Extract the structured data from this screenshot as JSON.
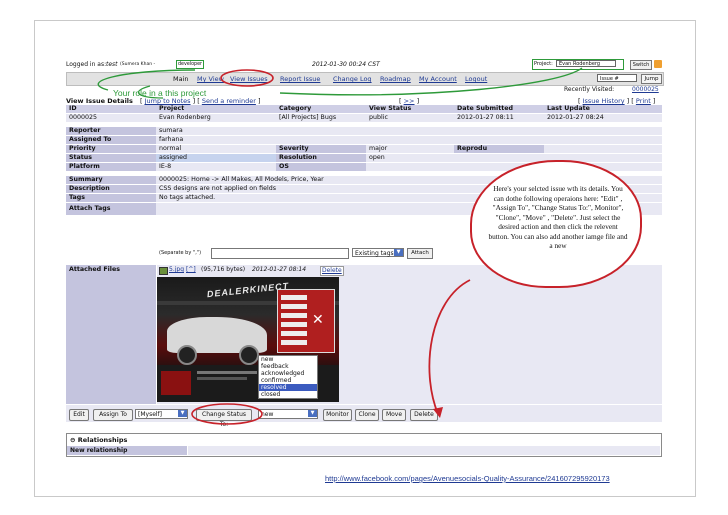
{
  "header": {
    "logged_in_prefix": "Logged in as:",
    "username": "test",
    "user_fullname": "(Sumera Khan -",
    "role": "developer",
    "role_suffix": ")",
    "datetime": "2012-01-30 00:24 CST",
    "project_label": "Project:",
    "project_value": "Evan Rodenberg",
    "switch_button": "Switch",
    "issue_input_placeholder": "Issue #",
    "jump_button": "Jump",
    "recently_visited_label": "Recently Visited:",
    "recently_visited_value": "0000025"
  },
  "nav": {
    "items": [
      "Main",
      "My View",
      "View Issues",
      "Report Issue",
      "Change Log",
      "Roadmap",
      "My Account",
      "Logout"
    ],
    "separator": "|"
  },
  "annotation_role": "Your role in a this project",
  "issue": {
    "section_title": "View Issue Details",
    "jump_to_notes": "Jump to Notes",
    "send_reminder": "Send a reminder",
    "next_link": ">>",
    "issue_history": "Issue History",
    "print": "Print",
    "columns": [
      "ID",
      "Project",
      "Category",
      "View Status",
      "Date Submitted",
      "Last Update"
    ],
    "values": [
      "0000025",
      "Evan Rodenberg",
      "[All Projects] Bugs",
      "public",
      "2012-01-27 08:11",
      "2012-01-27 08:24"
    ],
    "reporter_label": "Reporter",
    "reporter": "sumara",
    "assigned_label": "Assigned To",
    "assigned": "farhana",
    "priority_label": "Priority",
    "priority": "normal",
    "severity_label": "Severity",
    "severity": "major",
    "reproducibility_label": "Reprodu",
    "status_label": "Status",
    "status": "assigned",
    "resolution_label": "Resolution",
    "resolution": "open",
    "platform_label": "Platform",
    "platform": "IE-8",
    "os_label": "OS",
    "summary_label": "Summary",
    "summary": "0000025: Home -> All Makes, All Models, Price, Year",
    "description_label": "Description",
    "description": "CSS designs are not applied on fields",
    "tags_label": "Tags",
    "tags": "No tags attached.",
    "attach_tags_label": "Attach Tags",
    "separate_hint": "(Separate by \",\")",
    "existing_tags": "Existing tags",
    "attach_button": "Attach",
    "attached_files_label": "Attached Files",
    "file_name": "5.jpg",
    "file_bracket": "[^]",
    "file_size": "(95,716 bytes)",
    "file_date": "2012-01-27 08:14",
    "file_delete": "Delete",
    "screenshot_logo": "DEALERKINECT"
  },
  "actions": {
    "edit": "Edit",
    "assign_to": "Assign To",
    "assign_select": "[Myself]",
    "change_status": "Change Status To:",
    "status_select": "new",
    "monitor": "Monitor",
    "clone": "Clone",
    "move": "Move",
    "delete": "Delete"
  },
  "status_options": [
    "new",
    "feedback",
    "acknowledged",
    "confirmed",
    "resolved",
    "closed"
  ],
  "status_highlighted": "resolved",
  "relationships": {
    "title": "Relationships",
    "new_relationship": "New relationship"
  },
  "callout": {
    "text": "Here's your selcted issue wth its details. You can dothe following operaions here: \"Edit\" , \"Assign To\", \"Change Status To:\", Monitor\", \"Clone\", \"Move\" , \"Delete\". Just select the desired action and then click the relevent button. You can also add another iamge file and a new"
  },
  "footer_url": "http://www.facebook.com/pages/Avenuesocials-Quality-Assurance/241607295920173",
  "colors": {
    "annotation_red": "#c7222a",
    "annotation_green": "#2e9a3a",
    "label_bg": "#c4c4de",
    "value_bg": "#e8e8f3",
    "link_blue": "#1f3a93"
  }
}
